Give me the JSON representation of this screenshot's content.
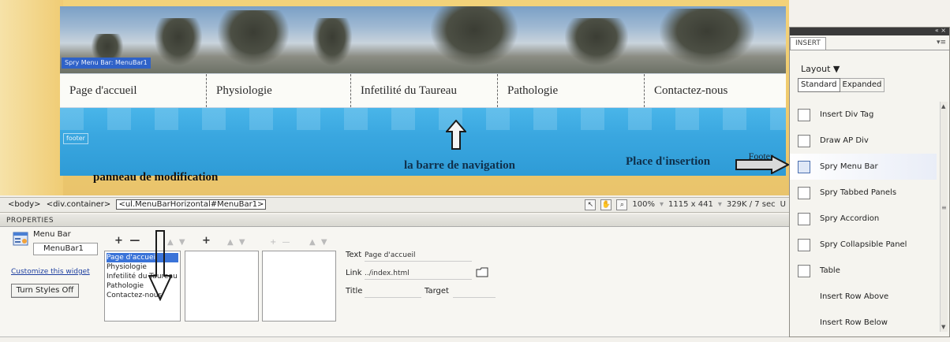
{
  "design": {
    "banner_tag": "Spry Menu Bar: MenuBar1",
    "menu_items": [
      "Page d'accueil",
      "Physiologie",
      "Infetilité du Taureau",
      "Pathologie",
      "Contactez-nous"
    ],
    "footer_tag": "footer",
    "footer_text": "Footer"
  },
  "annotations": {
    "nav_bar": "la barre de navigation",
    "insertion_point": "Place d'insertion",
    "modification_panel": "panneau de modification"
  },
  "tag_selector": {
    "tags": [
      "<body>",
      "<div.container>",
      "<ul.MenuBarHorizontal#MenuBar1>"
    ]
  },
  "status": {
    "zoom": "100%",
    "size": "1115 x 441",
    "download": "329K / 7 sec",
    "encoding": "U"
  },
  "properties": {
    "header": "PROPERTIES",
    "widget_type": "Menu Bar",
    "widget_id": "MenuBar1",
    "customize_link": "Customize this widget",
    "styles_button": "Turn Styles Off",
    "plus_minus": "+ —",
    "items": [
      "Page d'accueil",
      "Physiologie",
      "Infetilité du Taureau",
      "Pathologie",
      "Contactez-nous"
    ],
    "selected_item": "Page d'accueil",
    "text_label": "Text",
    "text_value": "Page d'accueil",
    "link_label": "Link",
    "link_value": "../index.html",
    "title_label": "Title",
    "target_label": "Target"
  },
  "insert_panel": {
    "tab": "INSERT",
    "category": "Layout ▼",
    "mode_standard": "Standard",
    "mode_expanded": "Expanded",
    "items": [
      {
        "label": "Insert Div Tag",
        "icon": "div-tag-icon"
      },
      {
        "label": "Draw AP Div",
        "icon": "ap-div-icon"
      },
      {
        "label": "Spry Menu Bar",
        "icon": "spry-menu-bar-icon"
      },
      {
        "label": "Spry Tabbed Panels",
        "icon": "tabbed-panels-icon"
      },
      {
        "label": "Spry Accordion",
        "icon": "accordion-icon"
      },
      {
        "label": "Spry Collapsible Panel",
        "icon": "collapsible-panel-icon"
      },
      {
        "label": "Table",
        "icon": "table-icon"
      },
      {
        "label": "Insert Row Above",
        "icon": "row-above-icon"
      },
      {
        "label": "Insert Row Below",
        "icon": "row-below-icon"
      }
    ]
  }
}
